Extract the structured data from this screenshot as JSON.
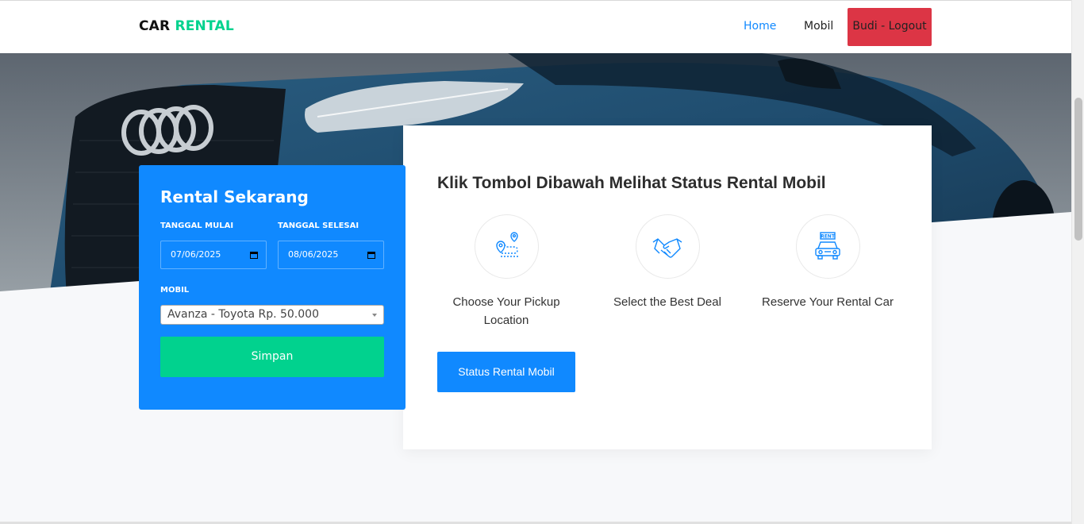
{
  "nav": {
    "brand_primary": "CAR",
    "brand_accent": "RENTAL",
    "links": [
      "Home",
      "Mobil"
    ],
    "logout_label": "Budi - Logout"
  },
  "form": {
    "title": "Rental Sekarang",
    "start_label": "TANGGAL MULAI",
    "start_value": "07/06/2025",
    "end_label": "TANGGAL SELESAI",
    "end_value": "08/06/2025",
    "car_label": "MOBIL",
    "car_selected": "Avanza - Toyota Rp. 50.000",
    "save_label": "Simpan"
  },
  "info": {
    "title": "Klik Tombol Dibawah Melihat Status Rental Mobil",
    "steps": [
      {
        "label": "Choose Your Pickup Location",
        "icon": "map-pin-route-icon"
      },
      {
        "label": "Select the Best Deal",
        "icon": "handshake-icon"
      },
      {
        "label": "Reserve Your Rental Car",
        "icon": "rent-car-icon"
      }
    ],
    "button_label": "Status Rental Mobil"
  },
  "colors": {
    "primary": "#1089ff",
    "accent": "#01d28e",
    "danger": "#dc3545"
  }
}
